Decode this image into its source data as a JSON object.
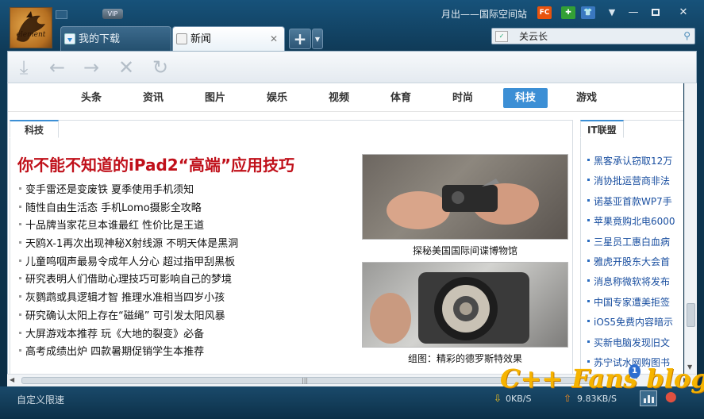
{
  "titlebar": {
    "vip_label": "VIP",
    "site_title": "月出——国际空间站",
    "fc_label": "FC",
    "logo_text": "element"
  },
  "tabs": [
    {
      "label": "我的下载"
    },
    {
      "label": "新闻"
    }
  ],
  "tab_close_glyph": "✕",
  "newtab_glyph": "+",
  "search": {
    "value": "关云长"
  },
  "nav": {
    "items": [
      "头条",
      "资讯",
      "图片",
      "娱乐",
      "视频",
      "体育",
      "时尚",
      "科技",
      "游戏"
    ],
    "active": "科技"
  },
  "left_panel": {
    "tab": "科技",
    "headline": "你不能不知道的iPad2“高端”应用技巧",
    "news": [
      "变手雷还是变废铁 夏季使用手机须知",
      "随性自由生活态 手机Lomo摄影全攻略",
      "十品牌当家花旦本谁最红 性价比是王道",
      "天鸥X-1再次出现神秘X射线源 不明天体是黑洞",
      "儿童鸣咽声最易令成年人分心 超过指甲刮黑板",
      "研究表明人们借助心理技巧可影响自己的梦境",
      "灰鹦鹉或具逻辑才智 推理水准相当四岁小孩",
      "研究确认太阳上存在“磁绳” 可引发太阳风暴",
      "大屏游戏本推荐 玩《大地的裂变》必备",
      "高考成绩出炉 四款暑期促销学生本推荐"
    ],
    "photos": [
      {
        "caption": "探秘美国国际间谍博物馆"
      },
      {
        "caption": "组图：精彩的德罗斯特效果"
      }
    ]
  },
  "right_panel": {
    "tab": "IT联盟",
    "items": [
      "黑客承认窃取12万",
      "消协批运营商非法",
      "诺基亚首款WP7手",
      "苹果竟购北电6000",
      "三星员工惠白血病",
      "雅虎开股东大会首",
      "消息称微软将发布",
      "中国专家遭美拒签",
      "iOS5免费内容暗示",
      "买新电脑发现旧文",
      "苏宁试水网购图书"
    ]
  },
  "statusbar": {
    "speed_label": "自定义限速",
    "down_speed": "0KB/S",
    "up_speed": "9.83KB/S"
  },
  "watermark": {
    "text": "C++ Fans blog",
    "badge": "1"
  },
  "colors": {
    "accent": "#3c8fd5",
    "headline": "#c0101a",
    "link": "#1a4fa0"
  }
}
